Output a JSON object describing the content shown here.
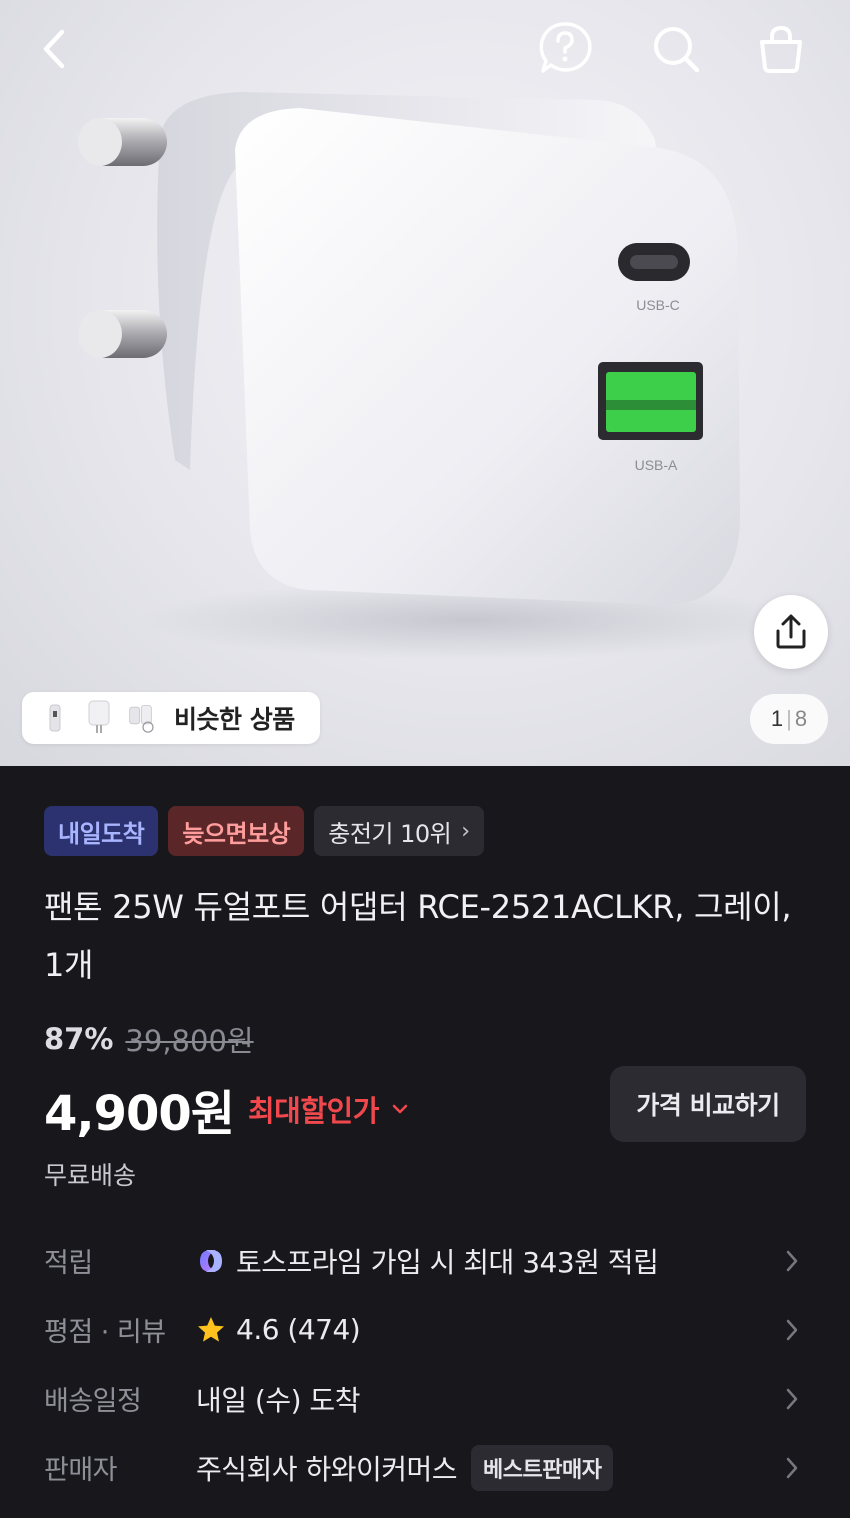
{
  "header": {
    "back_icon": "chevron-left-icon",
    "help_icon": "question-bubble-icon",
    "search_icon": "search-icon",
    "cart_icon": "shopping-bag-icon"
  },
  "gallery": {
    "port_c_label": "USB-C",
    "port_a_label": "USB-A",
    "similar_label": "비슷한 상품",
    "current_page": "1",
    "separator": "|",
    "total_pages": "8"
  },
  "tags": [
    {
      "label": "내일도착"
    },
    {
      "label": "늦으면보상"
    },
    {
      "label": "충전기 10위"
    }
  ],
  "product": {
    "title": "팬톤 25W 듀얼포트 어댑터 RCE-2521ACLKR, 그레이, 1개",
    "discount": "87%",
    "original_price": "39,800원",
    "price": "4,900원",
    "max_discount_label": "최대할인가",
    "compare_button": "가격 비교하기",
    "shipping": "무료배송"
  },
  "details": {
    "points": {
      "label": "적립",
      "value": "토스프라임 가입 시 최대 343원 적립"
    },
    "rating": {
      "label": "평점 · 리뷰",
      "value": "4.6 (474)"
    },
    "delivery": {
      "label": "배송일정",
      "value": "내일 (수) 도착"
    },
    "seller": {
      "label": "판매자",
      "value": "주식회사 하와이커머스",
      "badge": "베스트판매자"
    }
  },
  "colors": {
    "background": "#17171c",
    "accent_red": "#f0484c",
    "tag_blue_bg": "#2c3270",
    "tag_red_bg": "#5a2628",
    "usb_a_green": "#3ecf4a"
  }
}
